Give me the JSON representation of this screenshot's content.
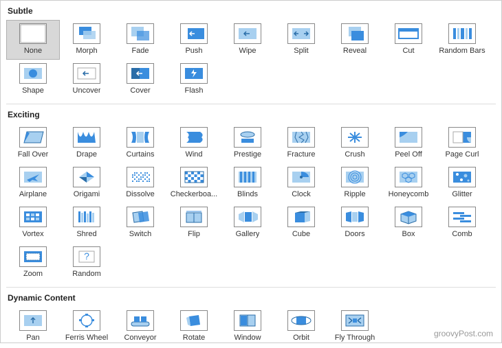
{
  "watermark": "groovyPost.com",
  "sections": [
    {
      "title": "Subtle",
      "items": [
        {
          "label": "None",
          "icon": "none",
          "selected": true
        },
        {
          "label": "Morph",
          "icon": "morph"
        },
        {
          "label": "Fade",
          "icon": "fade"
        },
        {
          "label": "Push",
          "icon": "push"
        },
        {
          "label": "Wipe",
          "icon": "wipe"
        },
        {
          "label": "Split",
          "icon": "split"
        },
        {
          "label": "Reveal",
          "icon": "reveal"
        },
        {
          "label": "Cut",
          "icon": "cut"
        },
        {
          "label": "Random Bars",
          "icon": "randombars"
        },
        {
          "label": "Shape",
          "icon": "shape"
        },
        {
          "label": "Uncover",
          "icon": "uncover"
        },
        {
          "label": "Cover",
          "icon": "cover"
        },
        {
          "label": "Flash",
          "icon": "flash"
        }
      ]
    },
    {
      "title": "Exciting",
      "items": [
        {
          "label": "Fall Over",
          "icon": "fallover"
        },
        {
          "label": "Drape",
          "icon": "drape"
        },
        {
          "label": "Curtains",
          "icon": "curtains"
        },
        {
          "label": "Wind",
          "icon": "wind"
        },
        {
          "label": "Prestige",
          "icon": "prestige"
        },
        {
          "label": "Fracture",
          "icon": "fracture"
        },
        {
          "label": "Crush",
          "icon": "crush"
        },
        {
          "label": "Peel Off",
          "icon": "peeloff"
        },
        {
          "label": "Page Curl",
          "icon": "pagecurl"
        },
        {
          "label": "Airplane",
          "icon": "airplane"
        },
        {
          "label": "Origami",
          "icon": "origami"
        },
        {
          "label": "Dissolve",
          "icon": "dissolve"
        },
        {
          "label": "Checkerboa...",
          "icon": "checker"
        },
        {
          "label": "Blinds",
          "icon": "blinds"
        },
        {
          "label": "Clock",
          "icon": "clock"
        },
        {
          "label": "Ripple",
          "icon": "ripple"
        },
        {
          "label": "Honeycomb",
          "icon": "honeycomb"
        },
        {
          "label": "Glitter",
          "icon": "glitter"
        },
        {
          "label": "Vortex",
          "icon": "vortex"
        },
        {
          "label": "Shred",
          "icon": "shred"
        },
        {
          "label": "Switch",
          "icon": "switch"
        },
        {
          "label": "Flip",
          "icon": "flip"
        },
        {
          "label": "Gallery",
          "icon": "gallery"
        },
        {
          "label": "Cube",
          "icon": "cube"
        },
        {
          "label": "Doors",
          "icon": "doors"
        },
        {
          "label": "Box",
          "icon": "box"
        },
        {
          "label": "Comb",
          "icon": "comb"
        },
        {
          "label": "Zoom",
          "icon": "zoom"
        },
        {
          "label": "Random",
          "icon": "random"
        }
      ]
    },
    {
      "title": "Dynamic Content",
      "items": [
        {
          "label": "Pan",
          "icon": "pan"
        },
        {
          "label": "Ferris Wheel",
          "icon": "ferris"
        },
        {
          "label": "Conveyor",
          "icon": "conveyor"
        },
        {
          "label": "Rotate",
          "icon": "rotate"
        },
        {
          "label": "Window",
          "icon": "window"
        },
        {
          "label": "Orbit",
          "icon": "orbit"
        },
        {
          "label": "Fly Through",
          "icon": "flythrough"
        }
      ]
    }
  ]
}
